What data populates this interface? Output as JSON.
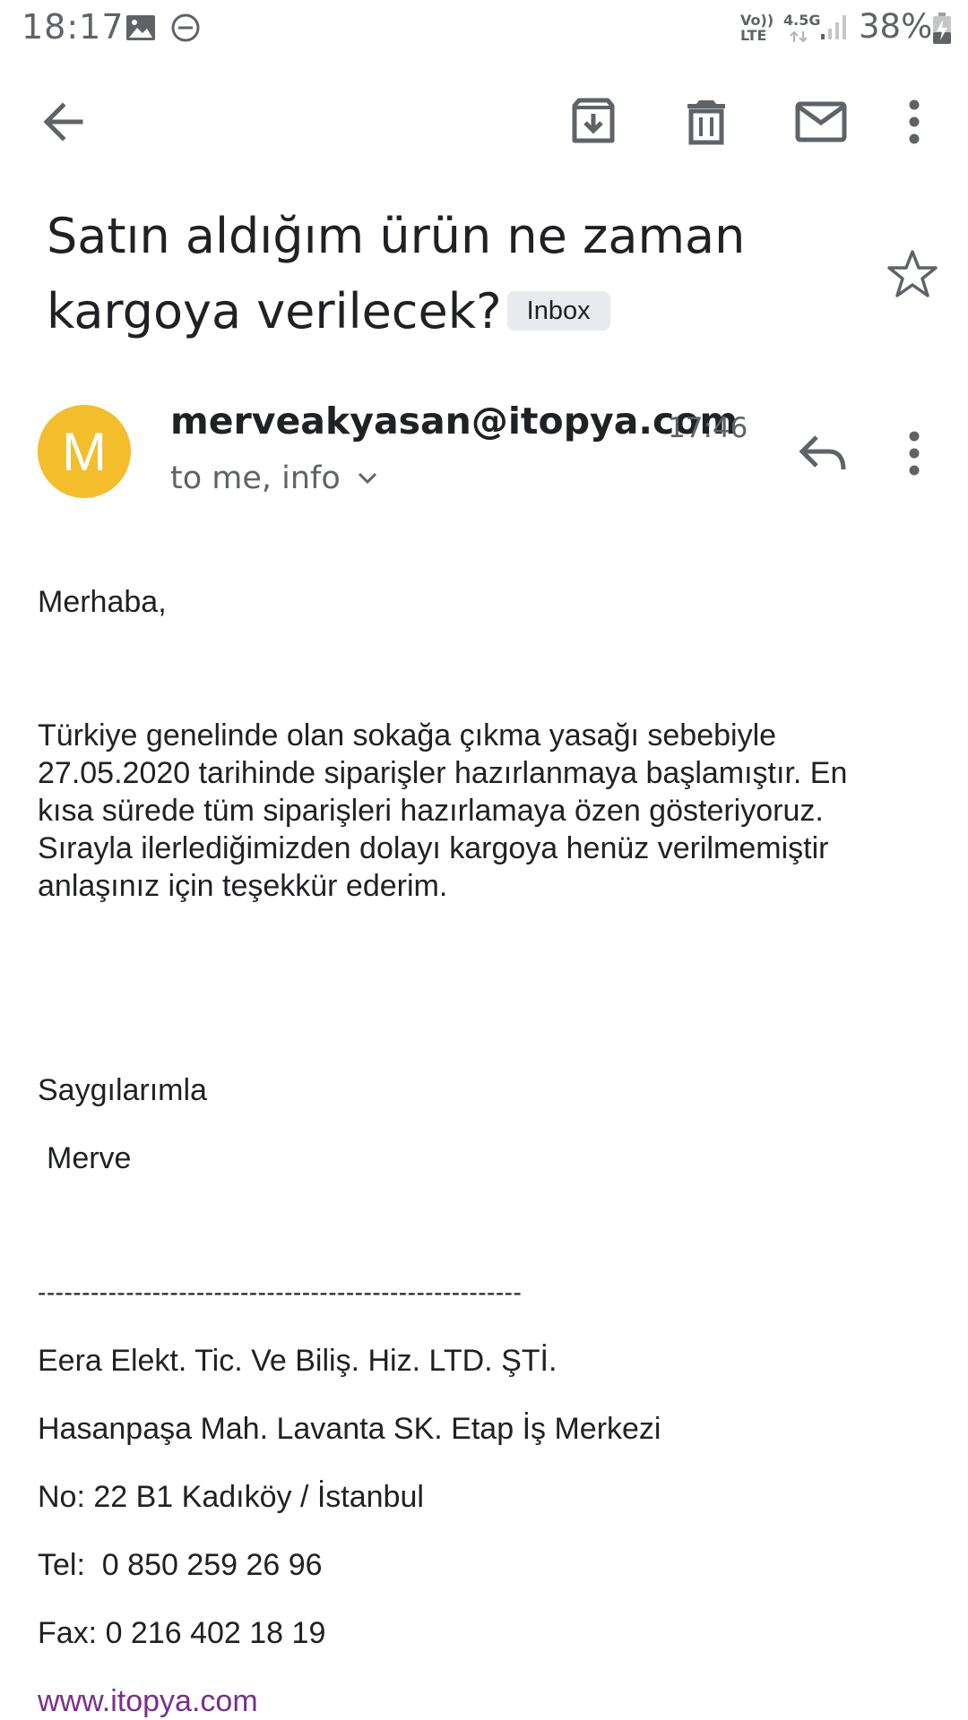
{
  "status_bar": {
    "time": "18:17",
    "battery": "38%",
    "network_top": "Vo))",
    "network_bottom": "LTE",
    "signal_label": "4.5G",
    "icons": [
      "image-icon",
      "do-not-disturb-icon",
      "signal-icon",
      "battery-charging-icon"
    ]
  },
  "toolbar": {
    "icons": [
      "back-arrow-icon",
      "archive-icon",
      "delete-icon",
      "mark-unread-icon",
      "more-vert-icon"
    ]
  },
  "email": {
    "subject_line1": "Satın aldığım ürün ne zaman",
    "subject_line2": "kargoya verilecek?",
    "label": "Inbox",
    "sender_initial": "M",
    "sender": "merveakyasan@itopya.com",
    "time": "17:46",
    "recipients": "to me, info",
    "avatar_color": "#f4bd2c"
  },
  "body": {
    "greeting": "Merhaba,",
    "paragraph": [
      "Türkiye genelinde olan sokağa çıkma yasağı sebebiyle",
      "27.05.2020 tarihinde siparişler hazırlanmaya başlamıştır. En",
      "kısa sürede tüm siparişleri hazırlamaya özen gösteriyoruz.",
      "Sırayla ilerlediğimizden dolayı kargoya henüz verilmemiştir",
      "anlaşınız için teşekkür ederim."
    ],
    "closing": "Saygılarımla",
    "name": "Merve",
    "divider": "-------------------------------------------------------",
    "company": "Eera Elekt. Tic. Ve Biliş. Hiz. LTD. ŞTİ.",
    "address1": "Hasanpaşa Mah. Lavanta SK. Etap İş Merkezi",
    "address2": "No: 22 B1 Kadıköy / İstanbul",
    "tel": "Tel:  0 850 259 26 96",
    "fax": "Fax: 0 216 402 18 19",
    "website": "www.itopya.com",
    "link_color": "#7a2e8e"
  }
}
